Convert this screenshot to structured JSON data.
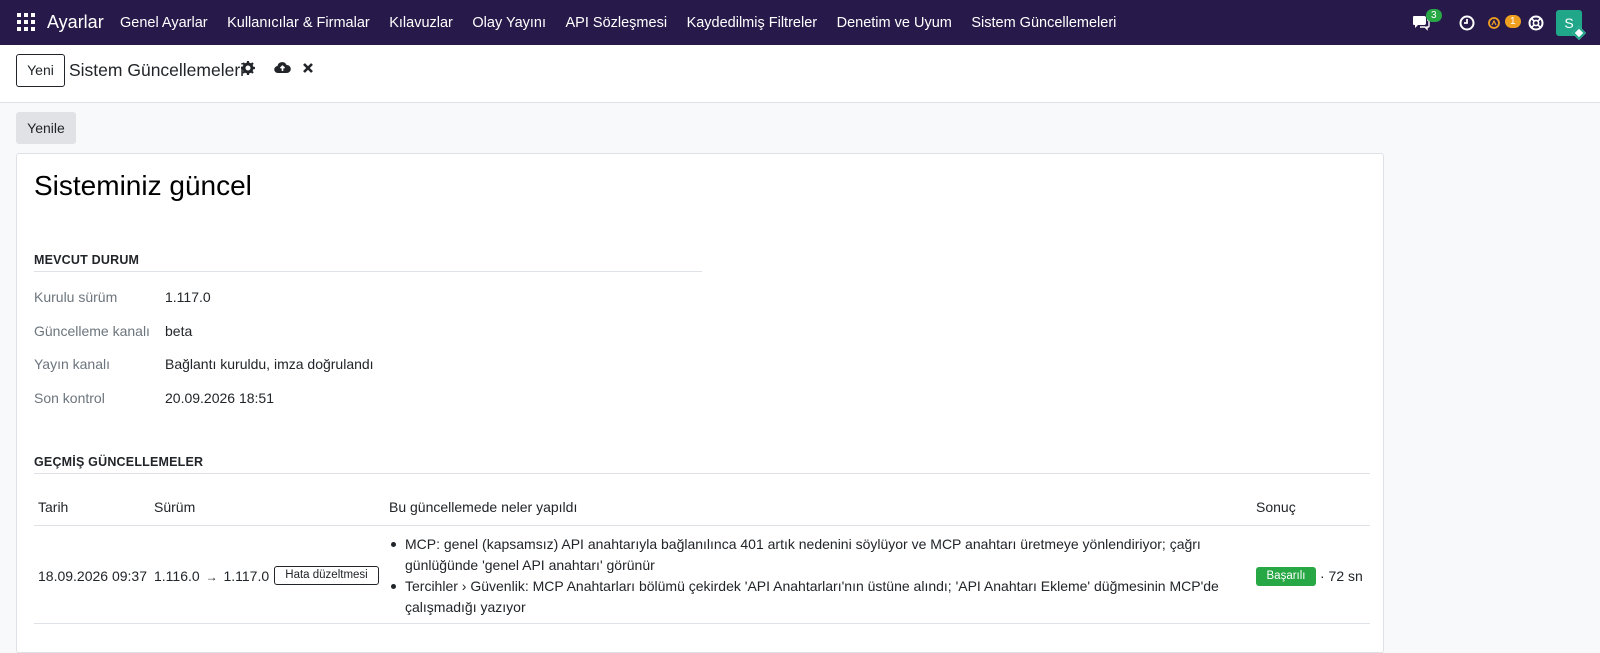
{
  "topbar": {
    "app_title": "Ayarlar",
    "menu": [
      "Genel Ayarlar",
      "Kullanıcılar & Firmalar",
      "Kılavuzlar",
      "Olay Yayını",
      "API Sözleşmesi",
      "Kaydedilmiş Filtreler",
      "Denetim ve Uyum",
      "Sistem Güncellemeleri"
    ],
    "messages_count": "3",
    "activity_count": "1",
    "avatar_letter": "S"
  },
  "control": {
    "new_label": "Yeni",
    "breadcrumb": "Sistem Güncellemeleri"
  },
  "refresh_label": "Yenile",
  "sheet": {
    "title": "Sisteminiz güncel",
    "current_section": "MEVCUT DURUM",
    "fields": [
      {
        "label": "Kurulu sürüm",
        "value": "1.117.0"
      },
      {
        "label": "Güncelleme kanalı",
        "value": "beta"
      },
      {
        "label": "Yayın kanalı",
        "value": "Bağlantı kuruldu, imza doğrulandı"
      },
      {
        "label": "Son kontrol",
        "value": "20.09.2026 18:51"
      }
    ],
    "history_section": "GEÇMİŞ GÜNCELLEMELER",
    "columns": [
      "Tarih",
      "Sürüm",
      "Bu güncellemede neler yapıldı",
      "Sonuç"
    ],
    "rows": [
      {
        "date": "18.09.2026 09:37",
        "from_version": "1.116.0",
        "arrow": "→",
        "to_version": "1.117.0",
        "type": "Hata düzeltmesi",
        "changes": [
          "MCP: genel (kapsamsız) API anahtarıyla bağlanılınca 401 artık nedenini söylüyor ve MCP anahtarı üretmeye yönlendiriyor; çağrı günlüğünde 'genel API anahtarı' görünür",
          "Tercihler › Güvenlik: MCP Anahtarları bölümü çekirdek 'API Anahtarları'nın üstüne alındı; 'API Anahtarı Ekleme' düğmesinin MCP'de çalışmadığı yazıyor"
        ],
        "result": "Başarılı",
        "duration": "· 72 sn"
      }
    ]
  },
  "colors": {
    "topbar": "#271a4b",
    "success": "#28a745",
    "avatar": "#20a78a",
    "badge_orange": "#f0a020"
  }
}
